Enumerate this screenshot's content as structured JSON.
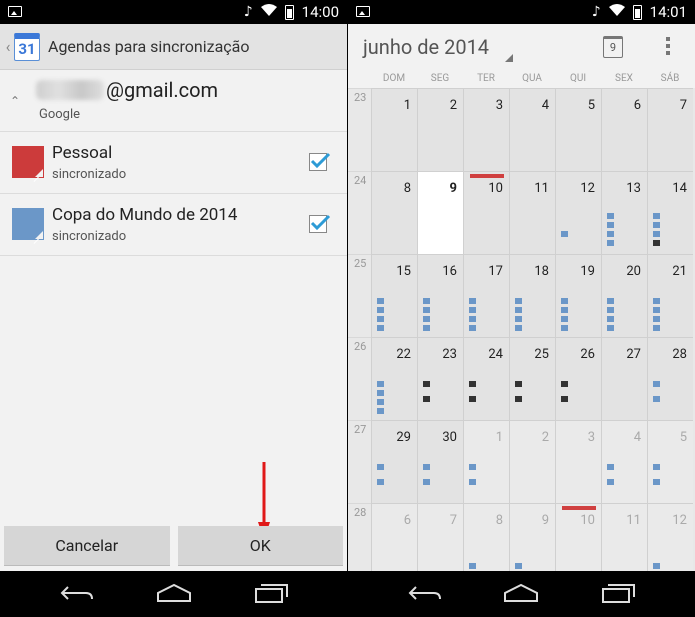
{
  "status_left": {
    "time": "14:00"
  },
  "status_right": {
    "time": "14:01"
  },
  "left": {
    "title": "Agendas para sincronização",
    "calendar_icon_number": "31",
    "account": {
      "email_suffix": "@gmail.com",
      "provider": "Google"
    },
    "calendars": [
      {
        "name": "Pessoal",
        "status": "sincronizado",
        "color": "#cc3b3b",
        "checked": true
      },
      {
        "name": "Copa do Mundo de 2014",
        "status": "sincronizado",
        "color": "#6b97c8",
        "checked": true
      }
    ],
    "cancel_label": "Cancelar",
    "ok_label": "OK"
  },
  "right": {
    "month_label": "junho de 2014",
    "today_icon_number": "9",
    "dow": [
      "DOM",
      "SEG",
      "TER",
      "QUA",
      "QUI",
      "SEX",
      "SÁB"
    ],
    "weeks": [
      {
        "num": "23",
        "days": [
          "1",
          "2",
          "3",
          "4",
          "5",
          "6",
          "7"
        ]
      },
      {
        "num": "24",
        "days": [
          "8",
          "9",
          "10",
          "11",
          "12",
          "13",
          "14"
        ]
      },
      {
        "num": "25",
        "days": [
          "15",
          "16",
          "17",
          "18",
          "19",
          "20",
          "21"
        ]
      },
      {
        "num": "26",
        "days": [
          "22",
          "23",
          "24",
          "25",
          "26",
          "27",
          "28"
        ]
      },
      {
        "num": "27",
        "days": [
          "29",
          "30",
          "1",
          "2",
          "3",
          "4",
          "5"
        ]
      },
      {
        "num": "28",
        "days": [
          "6",
          "7",
          "8",
          "9",
          "10",
          "11",
          "12"
        ]
      }
    ],
    "colors": {
      "blue_event": "#6b97c8",
      "dark_event": "#333333",
      "today_marker": "#d04040"
    }
  }
}
